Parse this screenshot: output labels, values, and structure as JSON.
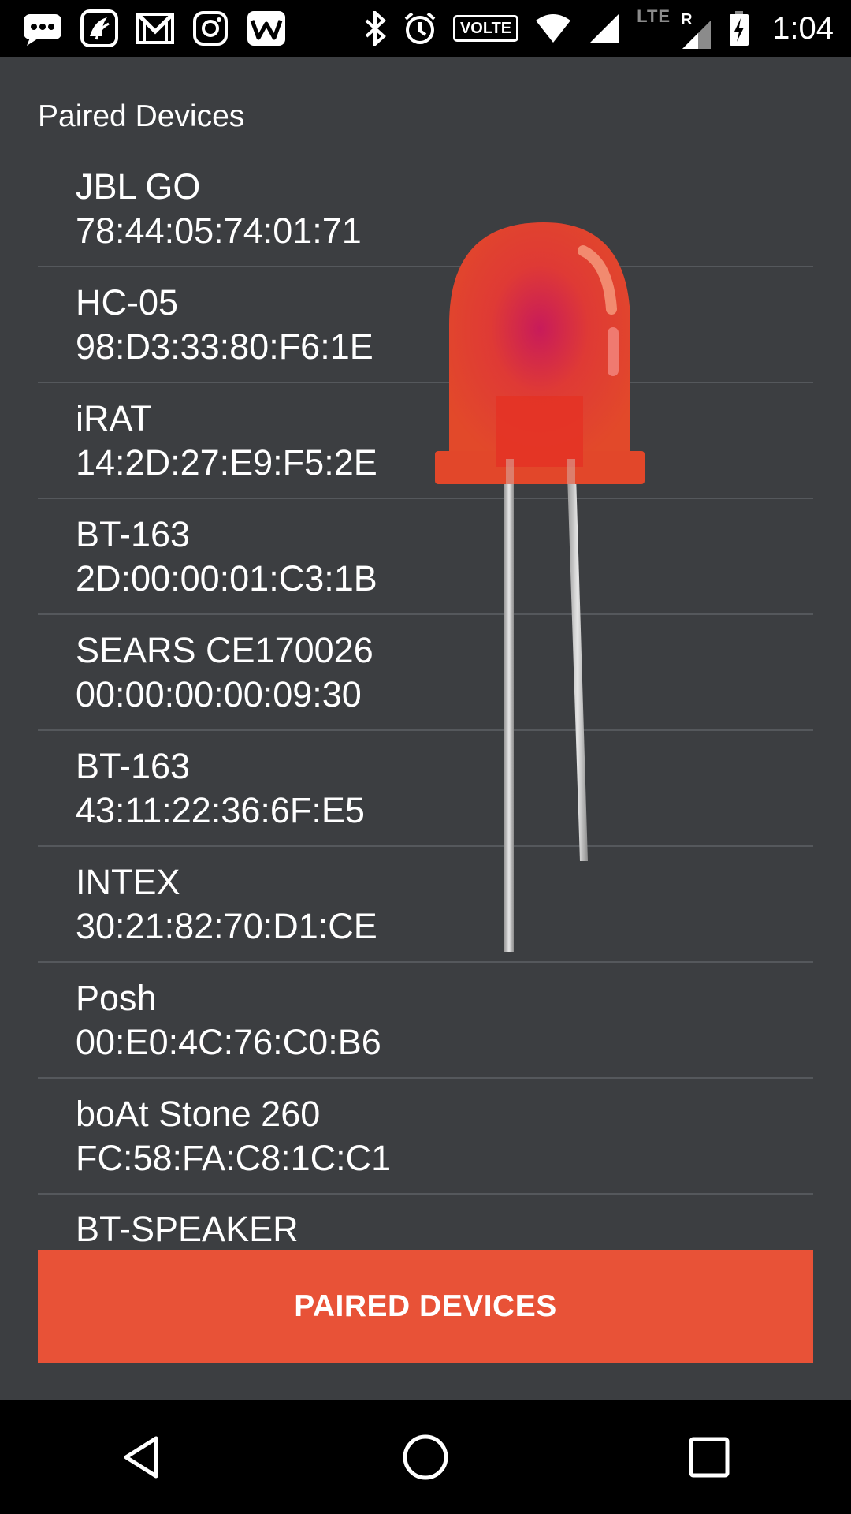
{
  "status_bar": {
    "time": "1:04",
    "volte_label": "VOLTE",
    "network_label": "LTE",
    "roaming_label": "R",
    "left_icons": [
      "messages-icon",
      "saavn-icon",
      "gmail-icon",
      "instagram-icon",
      "wattpad-icon"
    ],
    "right_icons": [
      "bluetooth-icon",
      "alarm-icon",
      "volte-icon",
      "wifi-icon",
      "signal-icon",
      "lte-signal-icon",
      "battery-charging-icon"
    ]
  },
  "main": {
    "section_title": "Paired Devices",
    "devices": [
      {
        "name": "JBL GO",
        "address": "78:44:05:74:01:71"
      },
      {
        "name": "HC-05",
        "address": "98:D3:33:80:F6:1E"
      },
      {
        "name": "iRAT",
        "address": "14:2D:27:E9:F5:2E"
      },
      {
        "name": "BT-163",
        "address": "2D:00:00:01:C3:1B"
      },
      {
        "name": "SEARS CE170026",
        "address": "00:00:00:00:09:30"
      },
      {
        "name": "BT-163",
        "address": "43:11:22:36:6F:E5"
      },
      {
        "name": "INTEX",
        "address": "30:21:82:70:D1:CE"
      },
      {
        "name": "Posh",
        "address": "00:E0:4C:76:C0:B6"
      },
      {
        "name": "boAt Stone 260",
        "address": "FC:58:FA:C8:1C:C1"
      },
      {
        "name": "BT-SPEAKER",
        "address": ""
      }
    ],
    "button_label": "PAIRED DEVICES",
    "led_image": "red-led-icon"
  },
  "nav_bar": {
    "buttons": [
      "back-icon",
      "home-icon",
      "recents-icon"
    ]
  },
  "colors": {
    "background": "#3c3e41",
    "accent": "#e85237",
    "divider": "#55585c",
    "bars": "#000000"
  }
}
